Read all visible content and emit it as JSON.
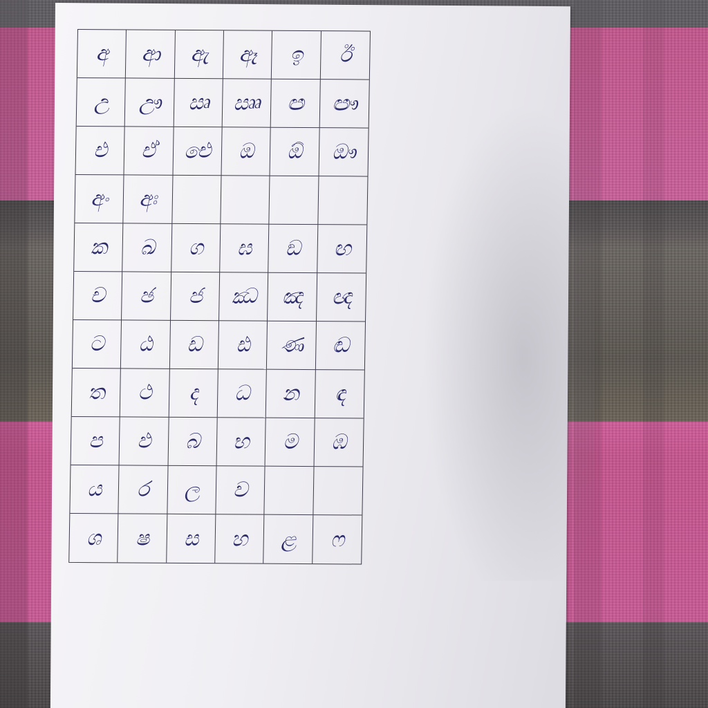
{
  "grid": {
    "rows": 11,
    "columns": 6,
    "cells": [
      [
        "අ",
        "ආ",
        "ඇ",
        "ඈ",
        "ඉ",
        "ඊ"
      ],
      [
        "උ",
        "ඌ",
        "ඍ",
        "ඎ",
        "ඏ",
        "ඐ"
      ],
      [
        "එ",
        "ඒ",
        "ඓ",
        "ඔ",
        "ඕ",
        "ඖ"
      ],
      [
        "අං",
        "අඃ",
        "",
        "",
        "",
        ""
      ],
      [
        "ක",
        "ඛ",
        "ග",
        "ඝ",
        "ඞ",
        "ඟ"
      ],
      [
        "ච",
        "ඡ",
        "ජ",
        "ඣ",
        "ඤ",
        "ඥ"
      ],
      [
        "ට",
        "ඨ",
        "ඩ",
        "ඪ",
        "ණ",
        "ඬ"
      ],
      [
        "ත",
        "ථ",
        "ද",
        "ධ",
        "න",
        "ඳ"
      ],
      [
        "ප",
        "ඵ",
        "බ",
        "භ",
        "ම",
        "ඹ"
      ],
      [
        "ය",
        "ර",
        "ල",
        "ව",
        "",
        ""
      ],
      [
        "ශ",
        "ෂ",
        "ස",
        "හ",
        "ළ",
        "ෆ"
      ]
    ]
  },
  "colors": {
    "ink": "#2c2d6a",
    "grid_line": "#3f3e4c",
    "paper": "#f3f2f6",
    "cloth_pink": "#c9609a",
    "cloth_grey": "#5b5650"
  }
}
